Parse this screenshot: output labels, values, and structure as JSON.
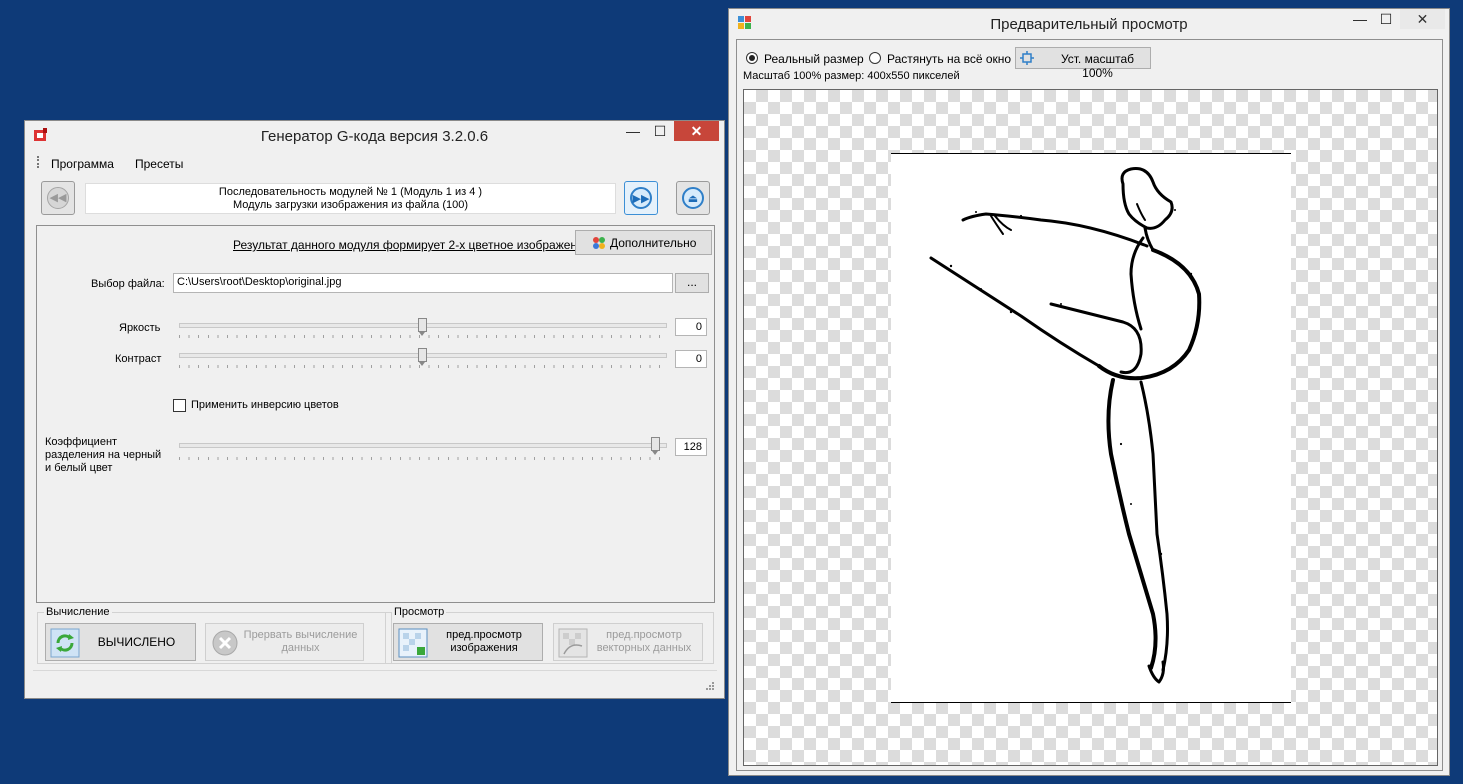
{
  "main_window": {
    "title": "Генератор G-кода версия 3.2.0.6",
    "controls": {
      "minimize": "—",
      "maximize": "☐",
      "close": "✕"
    },
    "menu": [
      "Программа",
      "Пресеты"
    ],
    "sequence": {
      "line1": "Последовательность модулей № 1 (Модуль 1 из 4 )",
      "line2": "Модуль загрузки изображения из файла (100)"
    },
    "result_link": "Результат данного модуля формирует 2-х цветное изображение",
    "more_button": "Дополнительно",
    "file": {
      "label": "Выбор файла:",
      "value": "C:\\Users\\root\\Desktop\\original.jpg",
      "browse": "..."
    },
    "brightness": {
      "label": "Яркость",
      "value": "0",
      "level": 0.5
    },
    "contrast": {
      "label": "Контраст",
      "value": "0",
      "level": 0.5
    },
    "invert": {
      "label": "Применить инверсию цветов",
      "checked": false
    },
    "threshold": {
      "label_lines": [
        "Коэффициент",
        "разделения на черный",
        "и белый цвет"
      ],
      "value": "128",
      "level": 0.98
    },
    "calc_group": {
      "title": "Вычисление",
      "calc_button": "ВЫЧИСЛЕНО",
      "abort_button": [
        "Прервать вычисление",
        "данных"
      ]
    },
    "preview_group": {
      "title": "Просмотр",
      "image_preview": [
        "пред.просмотр",
        "изображения"
      ],
      "vector_preview": [
        "пред.просмотр",
        "векторных данных"
      ]
    }
  },
  "preview_window": {
    "title": "Предварительный просмотр",
    "controls": {
      "minimize": "—",
      "maximize": "☐",
      "close": "✕"
    },
    "radio_real": "Реальный размер",
    "radio_stretch": "Растянуть на всё окно",
    "scale_button": "Уст. масштаб 100%",
    "scale_info": "Масштаб 100% размер: 400x550 пикселей"
  },
  "colors": {
    "desktop": "#0e3a78",
    "close_button": "#c7463a",
    "accent_blue": "#3c8fd6"
  }
}
